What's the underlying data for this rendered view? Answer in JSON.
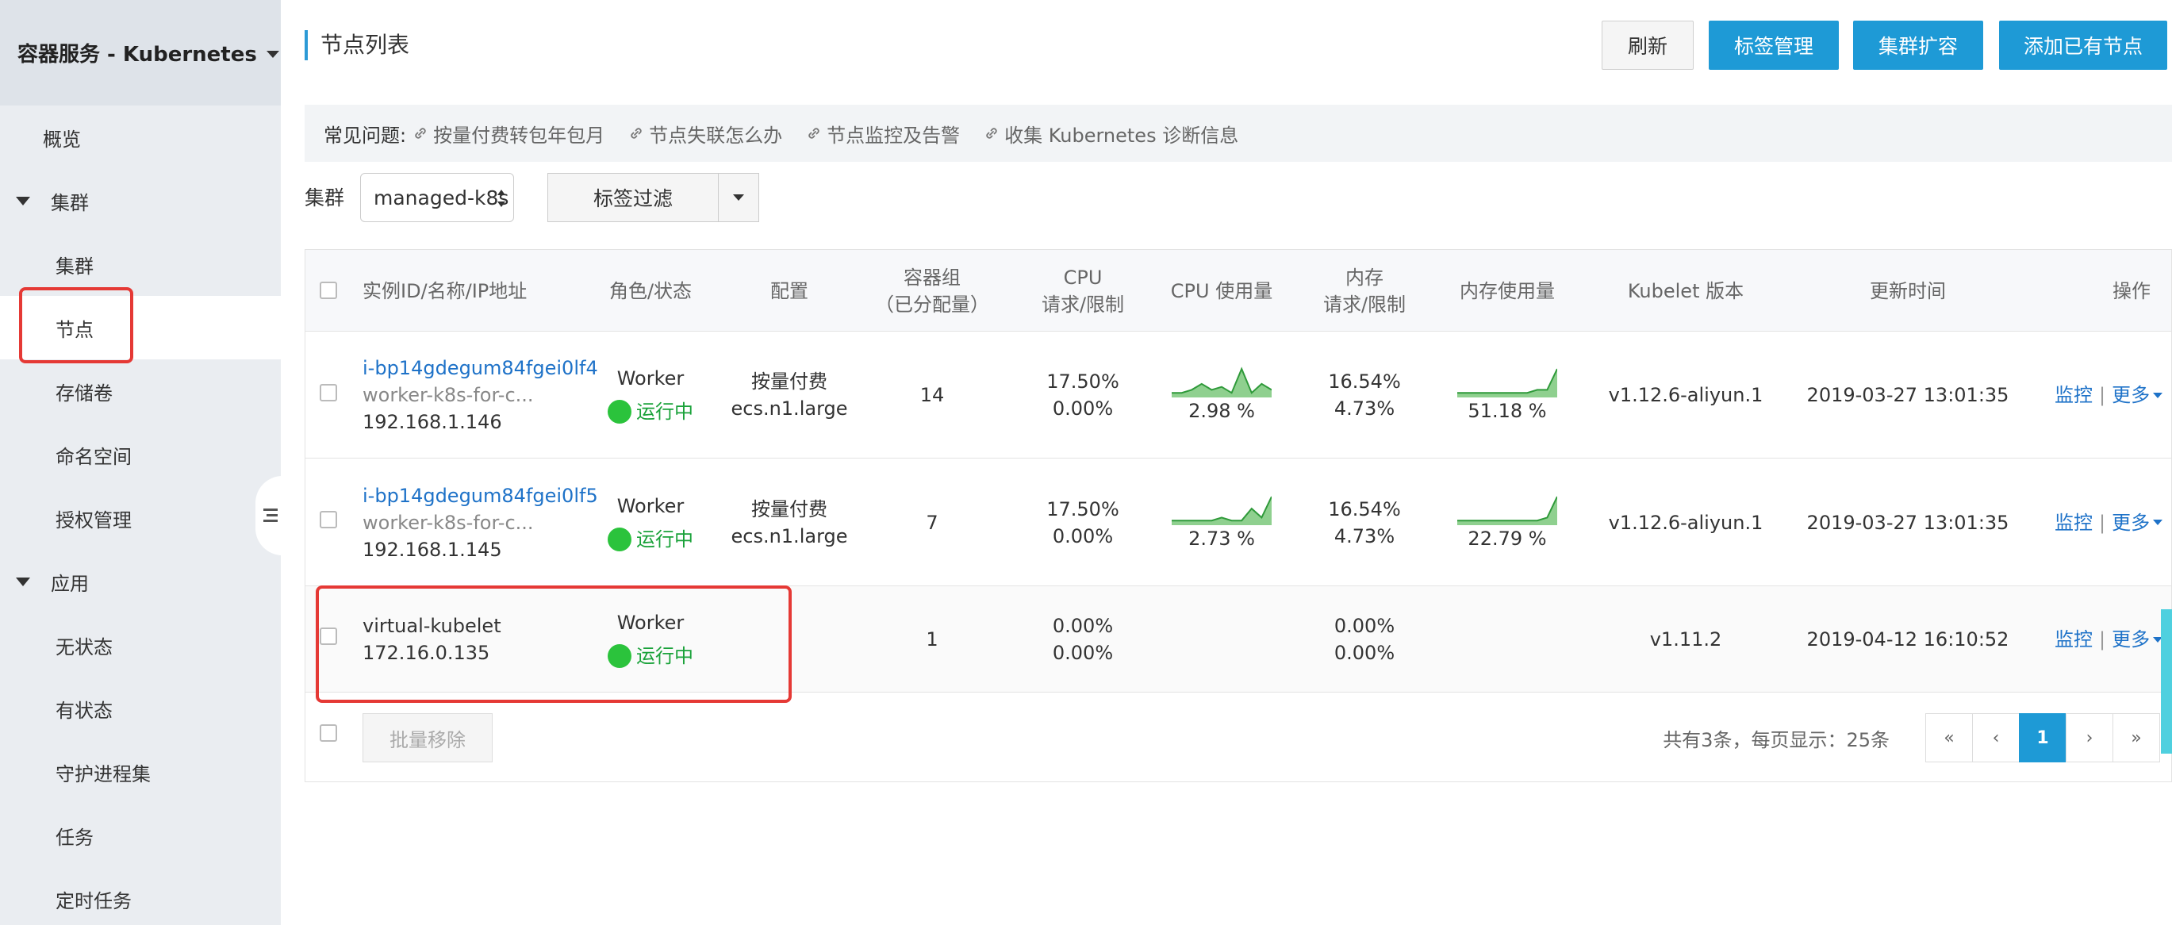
{
  "sidebar": {
    "title": "容器服务 - Kubernetes",
    "overview": "概览",
    "cluster_group": "集群",
    "cluster_items": [
      "集群",
      "节点",
      "存储卷",
      "命名空间",
      "授权管理"
    ],
    "app_group": "应用",
    "app_items": [
      "无状态",
      "有状态",
      "守护进程集",
      "任务",
      "定时任务"
    ]
  },
  "header": {
    "title": "节点列表",
    "buttons": [
      "刷新",
      "标签管理",
      "集群扩容",
      "添加已有节点"
    ]
  },
  "faq": {
    "label": "常见问题:",
    "links": [
      "按量付费转包年包月",
      "节点失联怎么办",
      "节点监控及告警",
      "收集 Kubernetes 诊断信息"
    ]
  },
  "filter": {
    "label": "集群",
    "cluster_value": "managed-k8s",
    "tag_filter": "标签过滤"
  },
  "table": {
    "headers": {
      "instance": "实例ID/名称/IP地址",
      "role": "角色/状态",
      "config": "配置",
      "pods_1": "容器组",
      "pods_2": "（已分配量）",
      "cpu_1": "CPU",
      "cpu_2": "请求/限制",
      "cpu_usage": "CPU 使用量",
      "mem_1": "内存",
      "mem_2": "请求/限制",
      "mem_usage": "内存使用量",
      "kubelet": "Kubelet 版本",
      "updated": "更新时间",
      "ops": "操作"
    },
    "rows": [
      {
        "id": "i-bp14gdegum84fgei0lf4",
        "name": "worker-k8s-for-c...",
        "ip": "192.168.1.146",
        "role": "Worker",
        "status": "运行中",
        "billing": "按量付费",
        "spec": "ecs.n1.large",
        "pods": "14",
        "cpu_req": "17.50%",
        "cpu_lim": "0.00%",
        "cpu_usage": "2.98 %",
        "cpu_spark": [
          1,
          1,
          2,
          4,
          2,
          3,
          1,
          9,
          1,
          4,
          2
        ],
        "mem_req": "16.54%",
        "mem_lim": "4.73%",
        "mem_usage": "51.18 %",
        "mem_spark": [
          1,
          1,
          1,
          1,
          1,
          1,
          1,
          1,
          2,
          2,
          9
        ],
        "kubelet": "v1.12.6-aliyun.1",
        "updated": "2019-03-27 13:01:35",
        "op_monitor": "监控",
        "op_more": "更多"
      },
      {
        "id": "i-bp14gdegum84fgei0lf5",
        "name": "worker-k8s-for-c...",
        "ip": "192.168.1.145",
        "role": "Worker",
        "status": "运行中",
        "billing": "按量付费",
        "spec": "ecs.n1.large",
        "pods": "7",
        "cpu_req": "17.50%",
        "cpu_lim": "0.00%",
        "cpu_usage": "2.73 %",
        "cpu_spark": [
          1,
          1,
          1,
          1,
          1,
          2,
          1,
          1,
          5,
          2,
          9
        ],
        "mem_req": "16.54%",
        "mem_lim": "4.73%",
        "mem_usage": "22.79 %",
        "mem_spark": [
          1,
          1,
          1,
          1,
          1,
          1,
          1,
          1,
          1,
          2,
          9
        ],
        "kubelet": "v1.12.6-aliyun.1",
        "updated": "2019-03-27 13:01:35",
        "op_monitor": "监控",
        "op_more": "更多"
      },
      {
        "id": "virtual-kubelet",
        "name": "",
        "ip": "172.16.0.135",
        "role": "Worker",
        "status": "运行中",
        "billing": "",
        "spec": "",
        "pods": "1",
        "cpu_req": "0.00%",
        "cpu_lim": "0.00%",
        "cpu_usage": "",
        "cpu_spark": [],
        "mem_req": "0.00%",
        "mem_lim": "0.00%",
        "mem_usage": "",
        "mem_spark": [],
        "kubelet": "v1.11.2",
        "updated": "2019-04-12 16:10:52",
        "op_monitor": "监控",
        "op_more": "更多"
      }
    ]
  },
  "footer": {
    "bulk_remove": "批量移除",
    "total": "共有3条，每页显示：25条",
    "pager": [
      "«",
      "‹",
      "1",
      "›",
      "»"
    ]
  },
  "colors": {
    "primary": "#1e9ad6",
    "link": "#1e72c8",
    "running": "#2bc33c",
    "highlight": "#e53935",
    "spark_fill": "#8fd08f",
    "spark_line": "#2f9a3a"
  }
}
